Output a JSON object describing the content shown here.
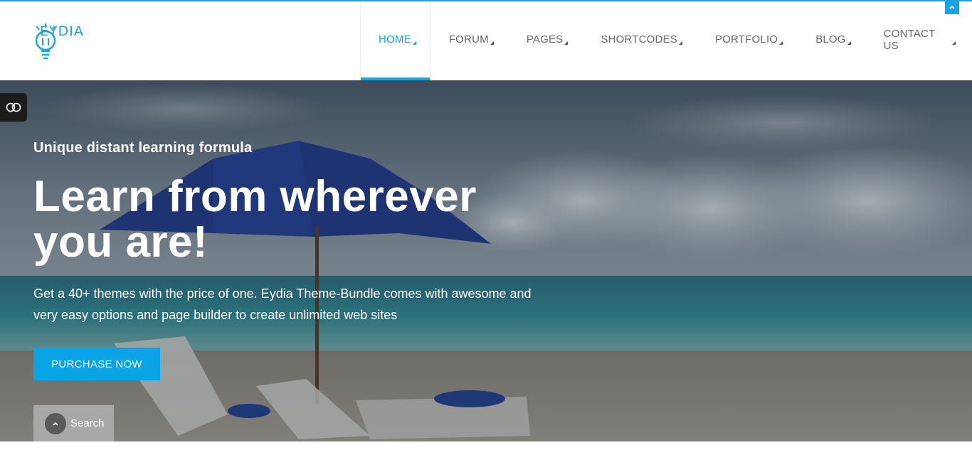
{
  "brand": {
    "name": "EYDIA",
    "color": "#1aa3e0"
  },
  "nav": {
    "items": [
      {
        "label": "HOME",
        "active": true
      },
      {
        "label": "FORUM",
        "active": false
      },
      {
        "label": "PAGES",
        "active": false
      },
      {
        "label": "SHORTCODES",
        "active": false
      },
      {
        "label": "PORTFOLIO",
        "active": false
      },
      {
        "label": "BLOG",
        "active": false
      },
      {
        "label": "CONTACT US",
        "active": false
      }
    ],
    "dropdown_icon": "triangle-icon"
  },
  "scroll_up": {
    "icon": "chevron-up-icon"
  },
  "settings_toggle": {
    "icon": "toggle-icon"
  },
  "hero": {
    "subtitle": "Unique distant learning formula",
    "headline": "Learn from wherever you are!",
    "description": "Get a 40+ themes with the price of one. Eydia Theme-Bundle comes with awesome and very easy options and page builder to create unlimited web sites",
    "cta_label": "PURCHASE NOW",
    "cta_color": "#0aa3e5"
  },
  "search": {
    "label": "Search",
    "icon": "chevron-up-icon"
  }
}
